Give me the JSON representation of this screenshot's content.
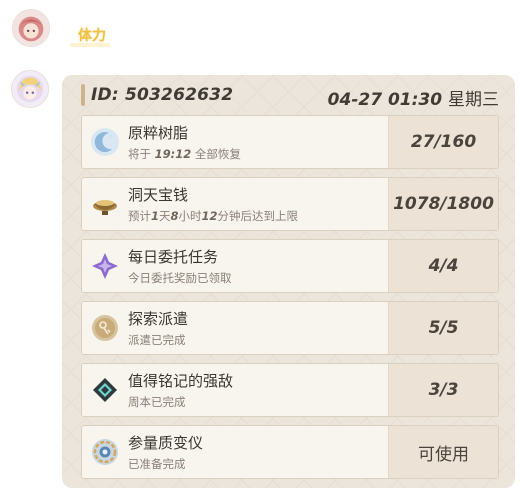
{
  "message1": {
    "trigger_text": "体力"
  },
  "card": {
    "uid_label": "ID:",
    "uid": "503262632",
    "datetime": "04-27 01:30",
    "weekday": "星期三",
    "rows": [
      {
        "icon": "resin-moon-icon",
        "title": "原粹树脂",
        "sub_prefix": "将于 ",
        "sub_highlight": "19:12",
        "sub_suffix": " 全部恢复",
        "value": "27/160"
      },
      {
        "icon": "treasure-bowl-icon",
        "title": "洞天宝钱",
        "sub_prefix": "预计",
        "sub_parts": [
          "1",
          "天",
          "8",
          "小时",
          "12",
          "分钟后达到上限"
        ],
        "value": "1078/1800"
      },
      {
        "icon": "commission-star-icon",
        "title": "每日委托任务",
        "sub_prefix": "今日委托奖励已领取",
        "value": "4/4"
      },
      {
        "icon": "expedition-icon",
        "title": "探索派遣",
        "sub_prefix": "派遣已完成",
        "value": "5/5"
      },
      {
        "icon": "weekly-boss-icon",
        "title": "值得铭记的强敌",
        "sub_prefix": "周本已完成",
        "value": "3/3"
      },
      {
        "icon": "transformer-icon",
        "title": "参量质变仪",
        "sub_prefix": "已准备完成",
        "value": "可使用"
      }
    ]
  }
}
